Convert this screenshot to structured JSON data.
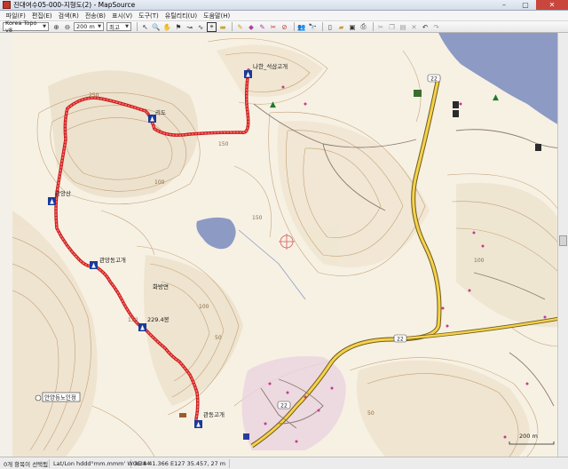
{
  "window": {
    "title": "?????05-000-???(2) - MapSource",
    "title_visible": "진대여수05-000-지형도(2) - MapSource",
    "minimize": "–",
    "maximize": "▢",
    "close": "✕"
  },
  "menu": [
    "파일(F)",
    "편집(E)",
    "검색(R)",
    "전송(B)",
    "표시(V)",
    "도구(T)",
    "유틸리티(U)",
    "도움말(H)"
  ],
  "toolbar": {
    "map_product": "Korea Topo v8",
    "zoom_level": "200 m",
    "detail": "최고"
  },
  "map": {
    "waypoints": [
      {
        "name": "나한_석삼고개"
      },
      {
        "name": "리도"
      },
      {
        "name": "관앙산"
      },
      {
        "name": "관앙동고개"
      },
      {
        "name": "229.4봉"
      },
      {
        "name": "관동고개"
      }
    ],
    "place_labels": {
      "village": "화방면",
      "poi_box": "안양동노인정"
    },
    "contour_labels": [
      "250",
      "150",
      "100",
      "100",
      "150",
      "100",
      "50",
      "150",
      "50"
    ],
    "road_numbers": [
      "22",
      "22",
      "22"
    ],
    "scale_bar": "200 m"
  },
  "status": {
    "selection": "0개 항목이 선택됨",
    "coord_format": "Lat/Lon hddd°mm.mmm' WGS 84",
    "coords": "N34 41.366 E127 35.457, 27 m"
  }
}
